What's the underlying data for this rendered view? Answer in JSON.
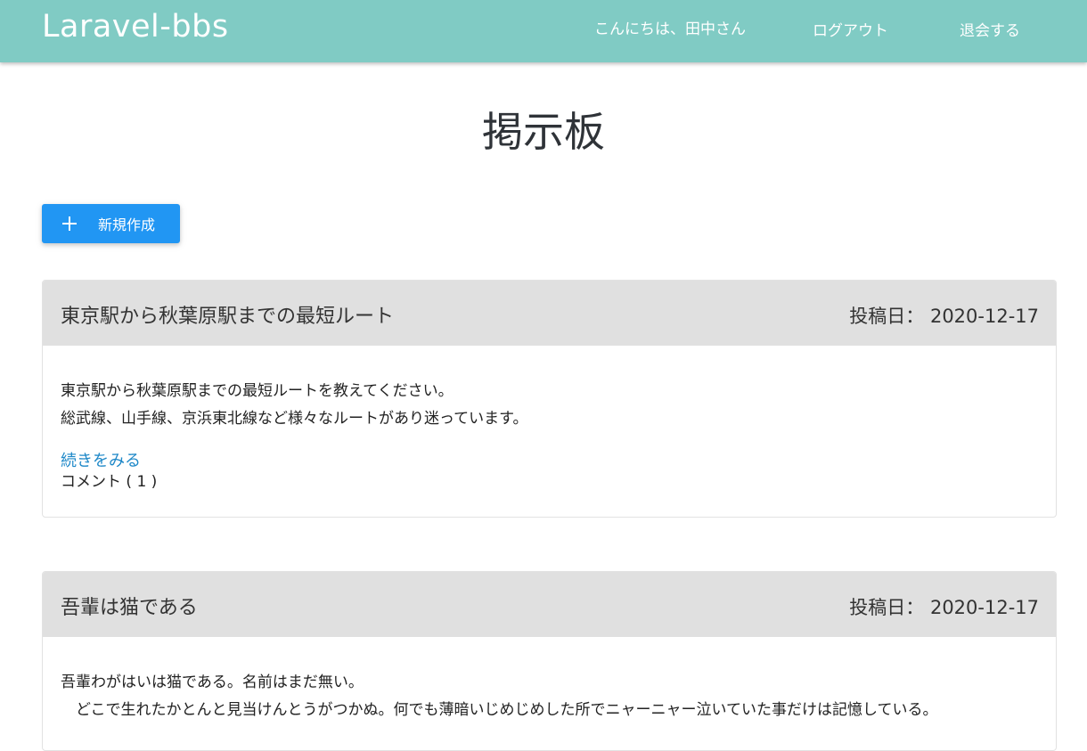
{
  "navbar": {
    "brand": "Laravel-bbs",
    "greeting": "こんにちは、田中さん",
    "logout": "ログアウト",
    "withdraw": "退会する",
    "bg_color": "#80cbc4"
  },
  "page": {
    "title": "掲示板"
  },
  "new_button": {
    "icon": "plus-icon",
    "label": "新規作成",
    "color": "#2196f3"
  },
  "posts": [
    {
      "title": "東京駅から秋葉原駅までの最短ルート",
      "date_label": "投稿日：",
      "date": "2020-12-17",
      "body_lines": [
        "東京駅から秋葉原駅までの最短ルートを教えてください。",
        "総武線、山手線、京浜東北線など様々なルートがあり迷っています。"
      ],
      "read_more": "続きをみる",
      "comments": "コメント ( 1 )"
    },
    {
      "title": "吾輩は猫である",
      "date_label": "投稿日：",
      "date": "2020-12-17",
      "body_lines": [
        "吾輩わがはいは猫である。名前はまだ無い。",
        "　どこで生れたかとんと見当けんとうがつかぬ。何でも薄暗いじめじめした所でニャーニャー泣いていた事だけは記憶している。"
      ]
    }
  ]
}
